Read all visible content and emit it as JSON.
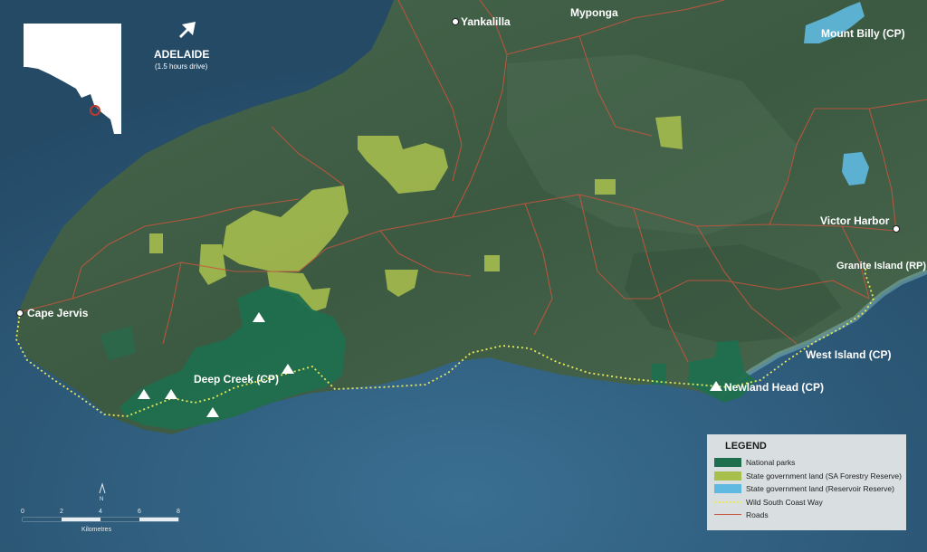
{
  "places": {
    "yankalilla": "Yankalilla",
    "myponga": "Myponga",
    "mount_billy": "Mount Billy (CP)",
    "victor_harbor": "Victor Harbor",
    "granite_island": "Granite Island (RP)",
    "west_island": "West Island (CP)",
    "newland_head": "Newland Head (CP)",
    "deep_creek": "Deep Creek (CP)",
    "cape_jervis": "Cape Jervis"
  },
  "inset": {
    "city": "ADELAIDE",
    "drive_time": "(1.5 hours drive)"
  },
  "scale": {
    "ticks": [
      "0",
      "2",
      "4",
      "6",
      "8"
    ],
    "unit": "Kilometres",
    "north": "N"
  },
  "legend": {
    "title": "LEGEND",
    "items": [
      {
        "label": "National parks",
        "color": "#1f6f4e"
      },
      {
        "label": "State government land (SA Forestry Reserve)",
        "color": "#a8bf4e"
      },
      {
        "label": "State government land (Reservoir Reserve)",
        "color": "#5fb9e0"
      },
      {
        "label": "Wild South Coast Way",
        "color": "#e8e85a"
      },
      {
        "label": "Roads",
        "color": "#c8553d"
      }
    ]
  },
  "colors": {
    "sea": "#2e5a78",
    "land": "#3f5e45",
    "national_park": "#1f6f4e",
    "forestry": "#a8bf4e",
    "reservoir": "#5fb9e0",
    "trail": "#e8e85a",
    "roads": "#c8553d"
  }
}
